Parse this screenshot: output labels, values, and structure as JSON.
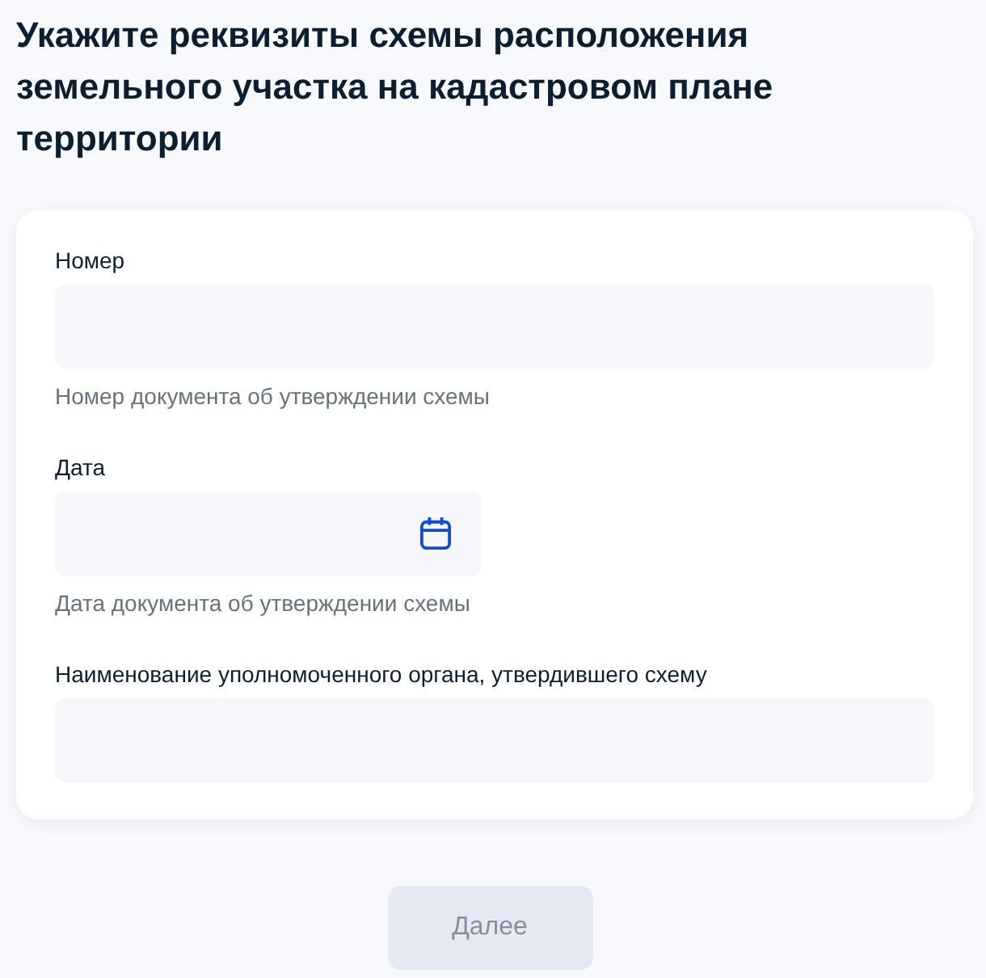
{
  "title": "Укажите реквизиты схемы расположения земельного участка на кадастровом плане территории",
  "fields": [
    {
      "kind": "text",
      "label": "Номер",
      "helper": "Номер документа об утверждении схемы"
    },
    {
      "kind": "date",
      "label": "Дата",
      "helper": "Дата документа об утверждении схемы"
    },
    {
      "kind": "text",
      "label": "Наименование уполномоченного органа, утвердившего схему"
    }
  ],
  "button": {
    "label": "Далее",
    "disabled": true
  }
}
